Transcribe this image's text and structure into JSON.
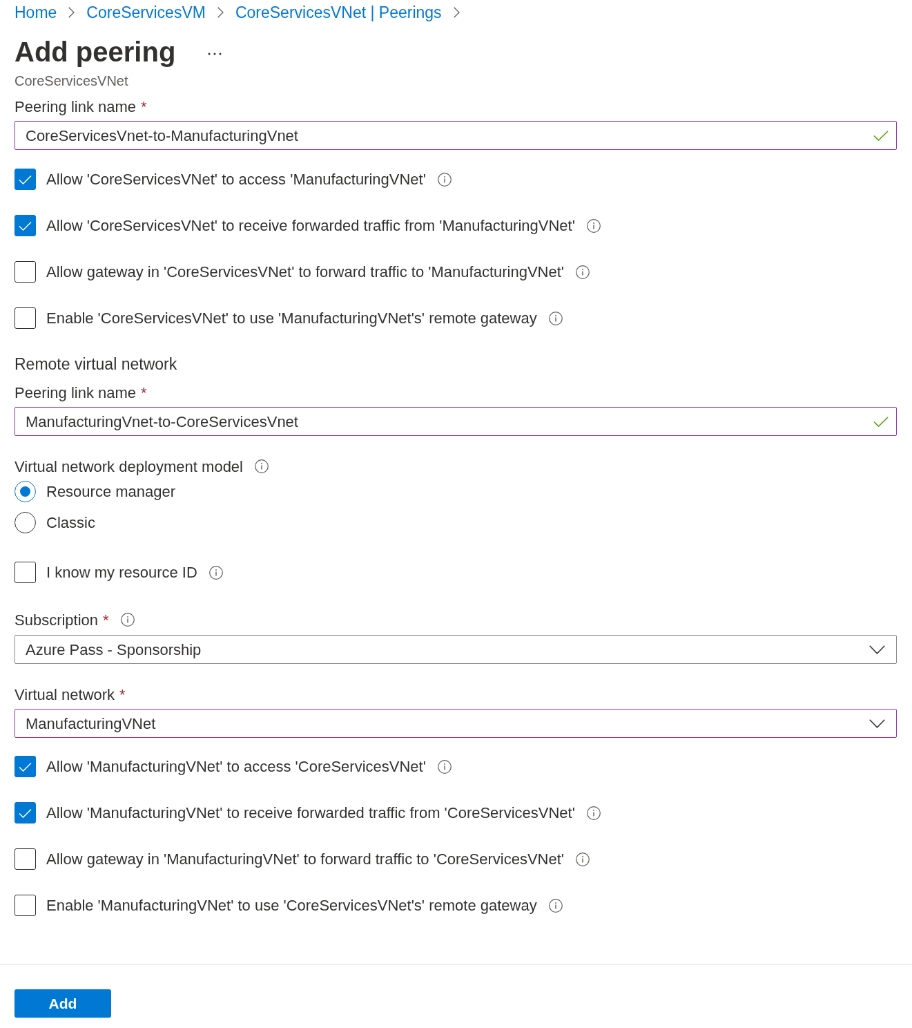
{
  "breadcrumb": [
    "Home",
    "CoreServicesVM",
    "CoreServicesVNet | Peerings"
  ],
  "header": {
    "title": "Add peering",
    "subtitle": "CoreServicesVNet"
  },
  "local_peering": {
    "link_name": {
      "label": "Peering link name",
      "required_mark": "*",
      "value": "CoreServicesVnet-to-ManufacturingVnet",
      "valid": true
    },
    "options": [
      {
        "label": "Allow 'CoreServicesVNet' to access 'ManufacturingVNet'",
        "checked": true,
        "info": true
      },
      {
        "label": "Allow 'CoreServicesVNet' to receive forwarded traffic from 'ManufacturingVNet'",
        "checked": true,
        "info": true
      },
      {
        "label": "Allow gateway in 'CoreServicesVNet' to forward traffic to 'ManufacturingVNet'",
        "checked": false,
        "info": true
      },
      {
        "label": "Enable 'CoreServicesVNet' to use 'ManufacturingVNet's' remote gateway",
        "checked": false,
        "info": true
      }
    ]
  },
  "remote_virtual_network": {
    "heading": "Remote virtual network",
    "link_name": {
      "label": "Peering link name",
      "required_mark": "*",
      "value": "ManufacturingVnet-to-CoreServicesVnet",
      "valid": true
    },
    "deployment_model": {
      "label": "Virtual network deployment model",
      "info": true,
      "options": [
        {
          "label": "Resource manager",
          "selected": true
        },
        {
          "label": "Classic",
          "selected": false
        }
      ]
    },
    "resource_id": {
      "label": "I know my resource ID",
      "checked": false,
      "info": true
    },
    "subscription": {
      "label": "Subscription",
      "required_mark": "*",
      "info": true,
      "value": "Azure Pass - Sponsorship",
      "valid": false
    },
    "virtual_network": {
      "label": "Virtual network",
      "required_mark": "*",
      "value": "ManufacturingVNet",
      "valid": true
    },
    "options": [
      {
        "label": "Allow 'ManufacturingVNet' to access 'CoreServicesVNet'",
        "checked": true,
        "info": true
      },
      {
        "label": "Allow 'ManufacturingVNet' to receive forwarded traffic from 'CoreServicesVNet'",
        "checked": true,
        "info": true
      },
      {
        "label": "Allow gateway in 'ManufacturingVNet' to forward traffic to 'CoreServicesVNet'",
        "checked": false,
        "info": true
      },
      {
        "label": "Enable 'ManufacturingVNet' to use 'CoreServicesVNet's' remote gateway",
        "checked": false,
        "info": true
      }
    ]
  },
  "actions": {
    "buttons": [
      "Add"
    ]
  }
}
